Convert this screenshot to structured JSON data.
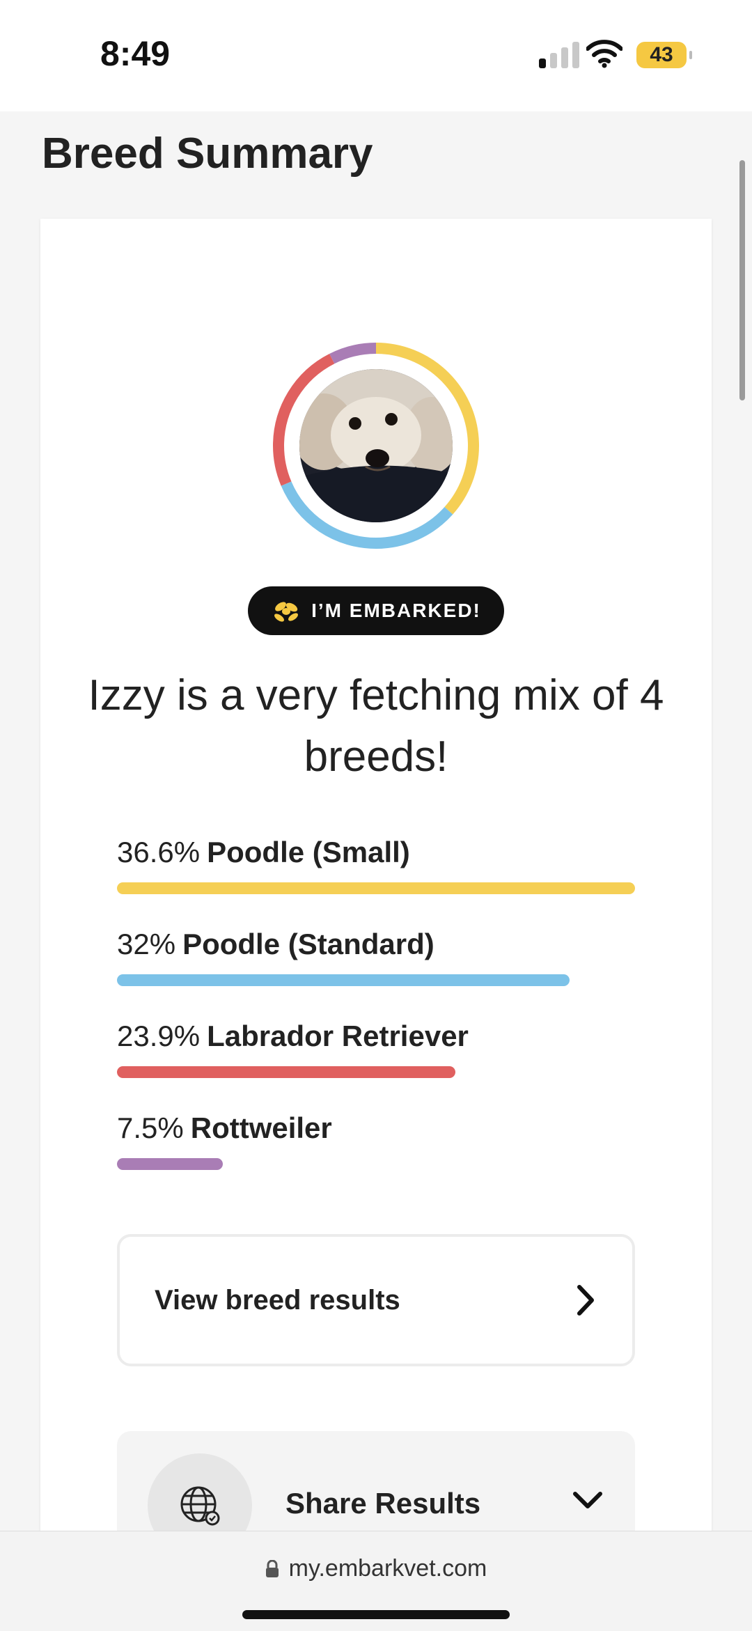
{
  "status_bar": {
    "time": "8:49",
    "battery": "43"
  },
  "page": {
    "title": "Breed Summary"
  },
  "profile": {
    "badge_label": "I’M EMBARKED!",
    "headline": "Izzy is a very fetching mix of 4 breeds!"
  },
  "breeds": [
    {
      "percent_label": "36.6%",
      "name": "Poodle (Small)",
      "percent": 36.6,
      "color": "#f5cf55"
    },
    {
      "percent_label": "32%",
      "name": "Poodle (Standard)",
      "percent": 32,
      "color": "#7cc2e8"
    },
    {
      "percent_label": "23.9%",
      "name": "Labrador Retriever",
      "percent": 23.9,
      "color": "#e0605f"
    },
    {
      "percent_label": "7.5%",
      "name": "Rottweiler",
      "percent": 7.5,
      "color": "#a97db5"
    }
  ],
  "actions": {
    "view_results_label": "View breed results",
    "share_label": "Share Results"
  },
  "browser": {
    "url": "my.embarkvet.com"
  },
  "icons": {
    "signal": "cellular-signal-icon",
    "wifi": "wifi-icon",
    "badge": "dog-balloon-icon",
    "chevron_right": "chevron-right-icon",
    "globe": "globe-icon",
    "chevron_down": "chevron-down-icon",
    "lock": "lock-icon"
  }
}
